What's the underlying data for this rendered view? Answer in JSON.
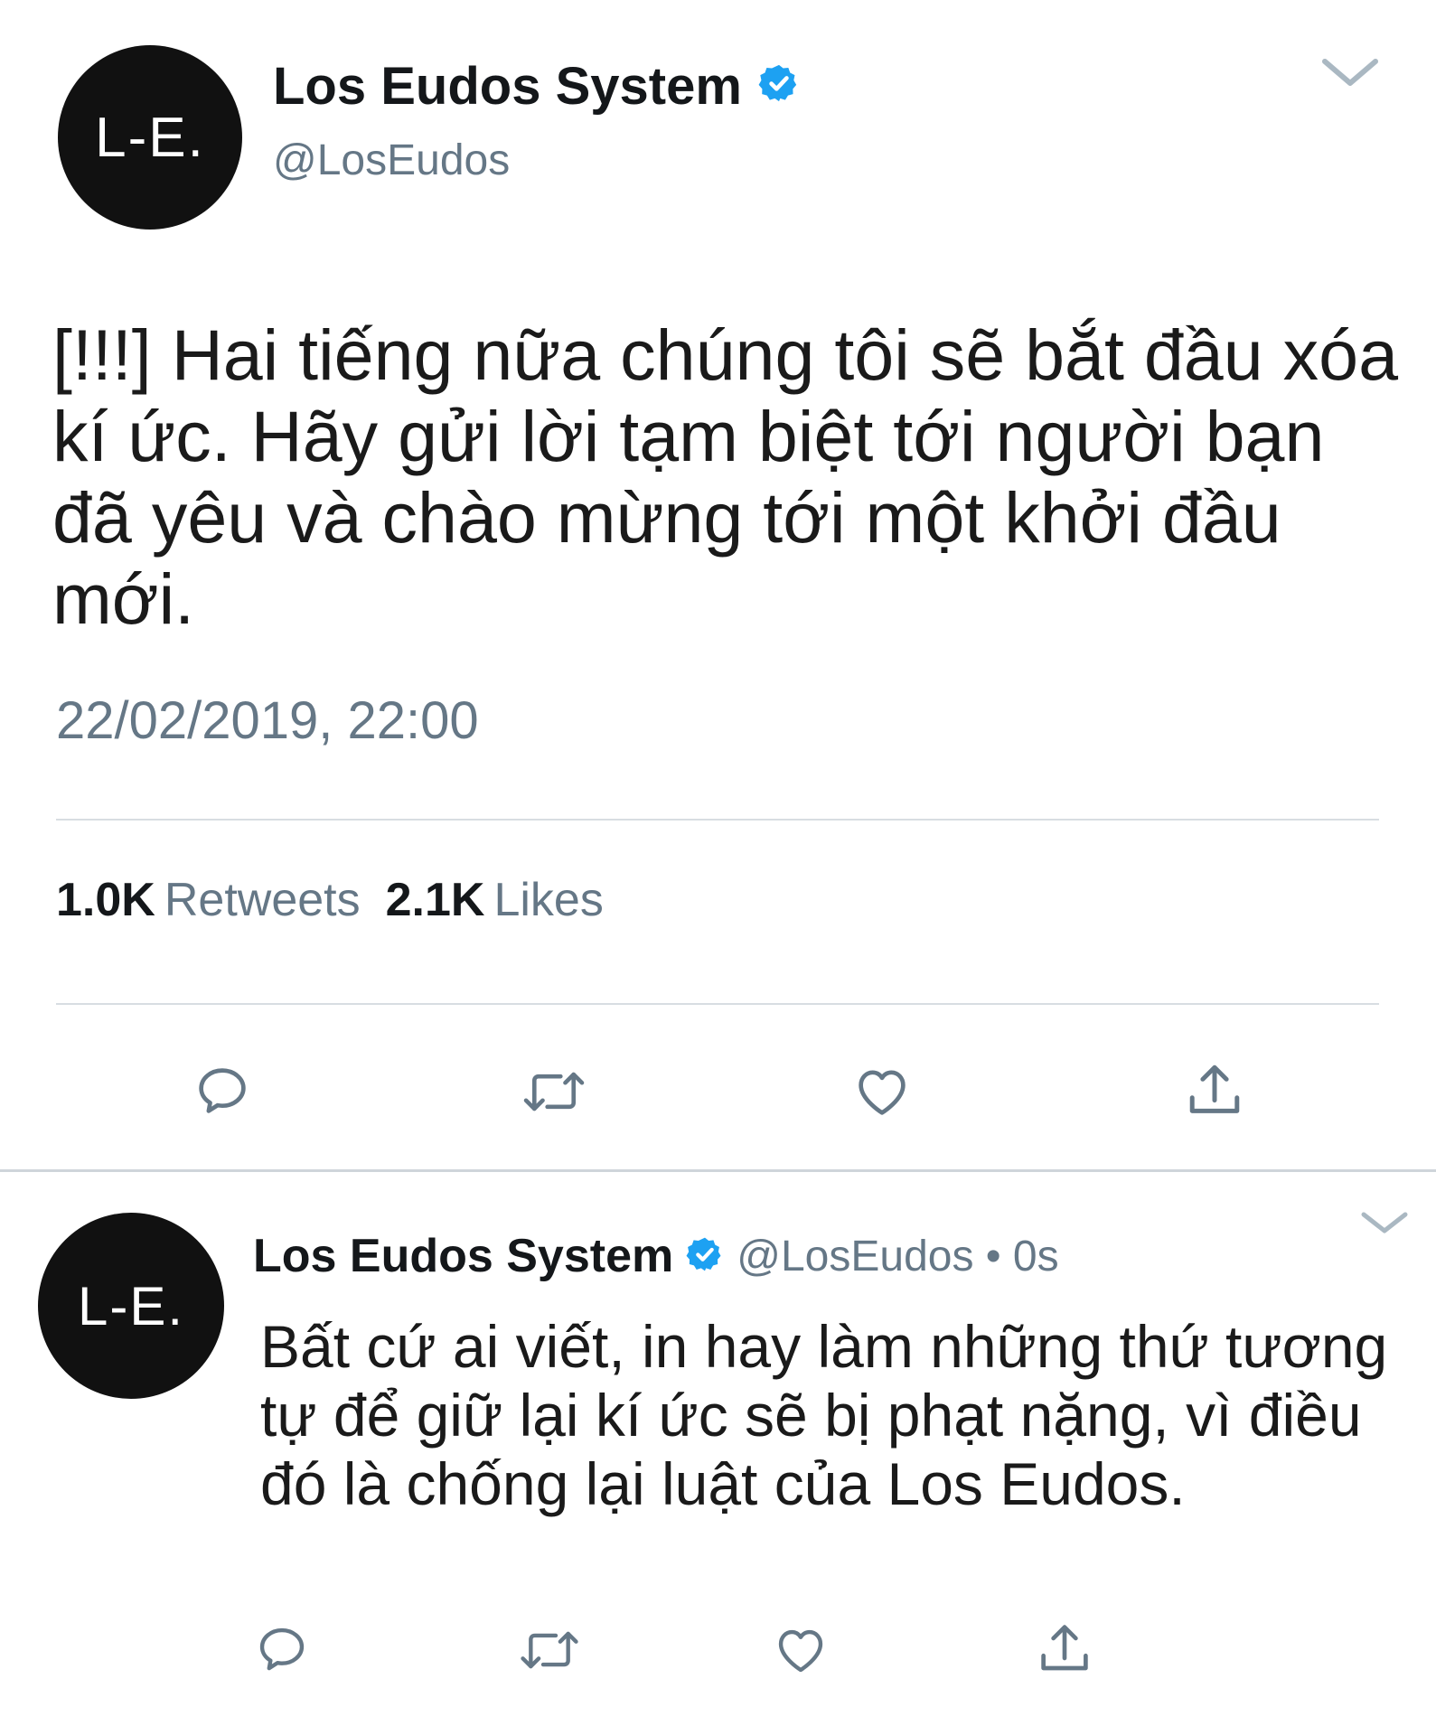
{
  "main_tweet": {
    "avatar_text": "L-E.",
    "display_name": "Los Eudos System",
    "handle": "@LosEudos",
    "text": "[!!!] Hai tiếng nữa chúng tôi sẽ bắt đầu xóa kí ức. Hãy gửi lời tạm biệt tới người bạn đã yêu và chào mừng tới một khởi đầu mới.",
    "timestamp": "22/02/2019, 22:00",
    "retweet_count": "1.0K",
    "retweet_label": "Retweets",
    "like_count": "2.1K",
    "like_label": "Likes",
    "icons": {
      "verified": "verified-badge-icon",
      "menu": "chevron-down-icon",
      "reply": "reply-icon",
      "retweet": "retweet-icon",
      "like": "heart-icon",
      "share": "share-icon"
    }
  },
  "reply_tweet": {
    "avatar_text": "L-E.",
    "display_name": "Los Eudos System",
    "handle_time": "@LosEudos • 0s",
    "text": "Bất cứ ai viết, in hay làm những thứ tương tự để giữ lại kí ức sẽ bị phạt nặng, vì điều đó là chống lại luật của Los Eudos."
  },
  "colors": {
    "verified_blue": "#1da1f2",
    "secondary_text": "#657786",
    "primary_text": "#14171a",
    "avatar_bg": "#111111"
  }
}
